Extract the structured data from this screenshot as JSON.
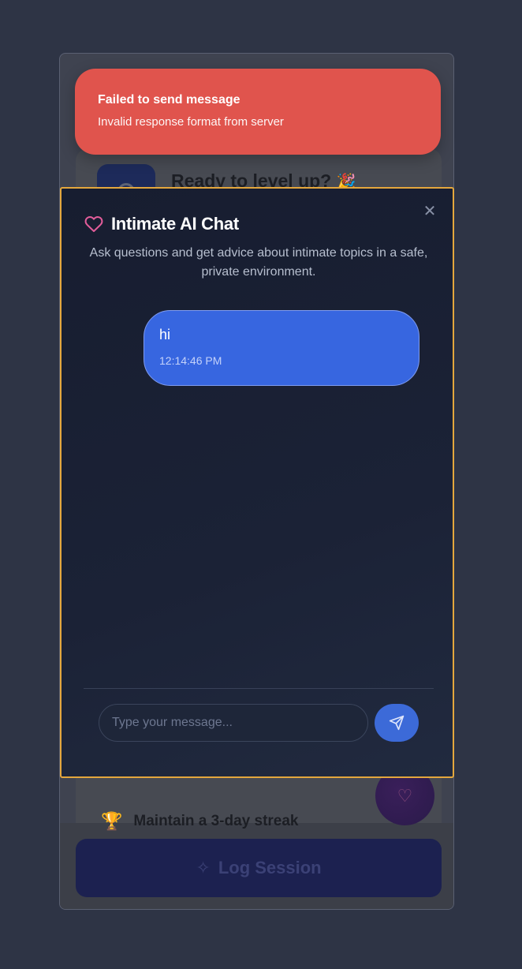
{
  "toast": {
    "title": "Failed to send message",
    "message": "Invalid response format from server",
    "color": "#e0544d"
  },
  "background": {
    "heading": "Ready to level up?",
    "heading_emoji": "🎉",
    "streak_goal": "Maintain a 3-day streak",
    "log_session_label": "Log Session"
  },
  "chat": {
    "title": "Intimate AI Chat",
    "description": "Ask questions and get advice about intimate topics in a safe, private environment.",
    "close_glyph": "✕",
    "messages": [
      {
        "role": "user",
        "text": "hi",
        "time": "12:14:46 PM"
      }
    ],
    "input_placeholder": "Type your message...",
    "accent_color": "#3766e0",
    "heart_color": "#e25d9a"
  }
}
